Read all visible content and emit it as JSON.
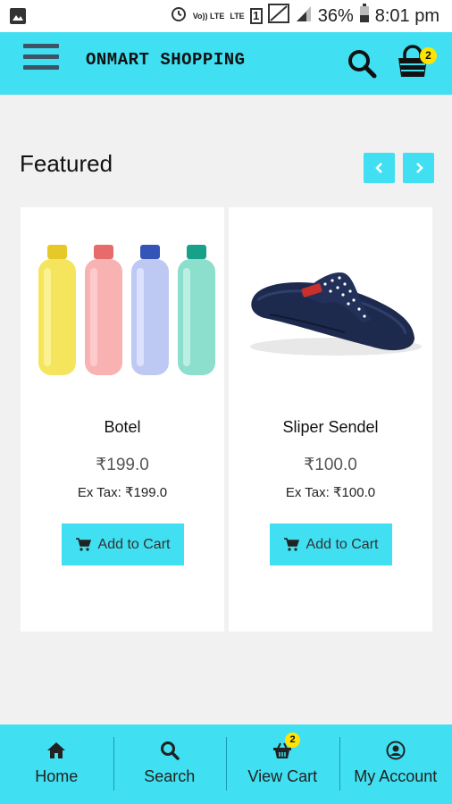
{
  "status_bar": {
    "volte_label": "Vo)) LTE",
    "lte_label": "LTE",
    "sim_slot": "1",
    "battery_percent": "36%",
    "time": "8:01 pm"
  },
  "app_bar": {
    "title": "ONMART SHOPPING",
    "cart_count": "2"
  },
  "featured": {
    "title": "Featured",
    "products": [
      {
        "name": "Botel",
        "price": "₹199.0",
        "ex_tax_label": "Ex Tax:",
        "ex_tax_value": "₹199.0",
        "button_label": "Add to Cart"
      },
      {
        "name": "Sliper Sendel",
        "price": "₹100.0",
        "ex_tax_label": "Ex Tax:",
        "ex_tax_value": "₹100.0",
        "button_label": "Add to Cart"
      }
    ]
  },
  "bottom_nav": {
    "items": [
      {
        "label": "Home",
        "icon": "home-icon"
      },
      {
        "label": "Search",
        "icon": "search-icon"
      },
      {
        "label": "View Cart",
        "icon": "basket-icon",
        "badge": "2"
      },
      {
        "label": "My Account",
        "icon": "account-icon"
      }
    ]
  },
  "colors": {
    "accent": "#40dff1",
    "badge": "#ffe400",
    "background": "#f1f1f1"
  }
}
